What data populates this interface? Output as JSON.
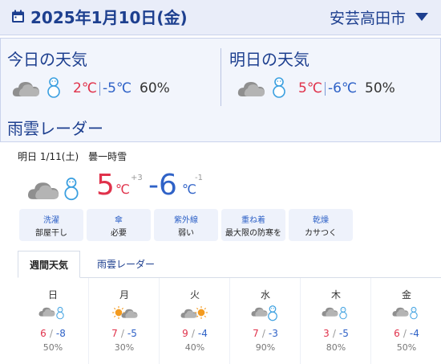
{
  "header": {
    "calendar_icon": "calendar-icon",
    "date": "2025年1月10日(金)",
    "location": "安芸高田市",
    "dropdown_icon": "chevron-down-icon"
  },
  "today": {
    "title": "今日の天気",
    "icon": "cloud-snow-icon",
    "high": "2℃",
    "low": "-5℃",
    "pop": "60%"
  },
  "tomorrow": {
    "title": "明日の天気",
    "icon": "cloud-snow-icon",
    "high": "5℃",
    "low": "-6℃",
    "pop": "50%"
  },
  "radar_title": "雨雲レーダー",
  "detail": {
    "day_label": "明日 1/11(土)",
    "weather_text": "曇一時雪",
    "icon": "cloud-snow-icon",
    "high": "5",
    "high_unit": "℃",
    "high_diff": "+3",
    "low": "-6",
    "low_unit": "℃",
    "low_diff": "-1"
  },
  "indices": [
    {
      "title": "洗濯",
      "value": "部屋干し"
    },
    {
      "title": "傘",
      "value": "必要"
    },
    {
      "title": "紫外線",
      "value": "弱い"
    },
    {
      "title": "重ね着",
      "value": "最大限の防寒を"
    },
    {
      "title": "乾燥",
      "value": "カサつく"
    }
  ],
  "tabs": [
    {
      "label": "週間天気",
      "active": true
    },
    {
      "label": "雨雲レーダー",
      "active": false
    }
  ],
  "week": [
    {
      "day": "日",
      "icon": "cloud-snow-icon",
      "high": "6",
      "low": "-8",
      "pop": "50%"
    },
    {
      "day": "月",
      "icon": "sun-cloud-icon",
      "high": "7",
      "low": "-5",
      "pop": "30%"
    },
    {
      "day": "火",
      "icon": "cloud-sun-icon",
      "high": "9",
      "low": "-4",
      "pop": "40%"
    },
    {
      "day": "水",
      "icon": "cloud-snowman-icon",
      "high": "7",
      "low": "-3",
      "pop": "90%"
    },
    {
      "day": "木",
      "icon": "cloud-snow-icon",
      "high": "3",
      "low": "-5",
      "pop": "80%"
    },
    {
      "day": "金",
      "icon": "cloud-snow-icon",
      "high": "6",
      "low": "-4",
      "pop": "50%"
    }
  ],
  "temp_separator": "/",
  "colors": {
    "brand": "#1d3f8f",
    "high": "#e0324b",
    "low": "#2f62c7",
    "header_bg": "#e9edf9",
    "panel_bg": "#f2f5fc"
  }
}
